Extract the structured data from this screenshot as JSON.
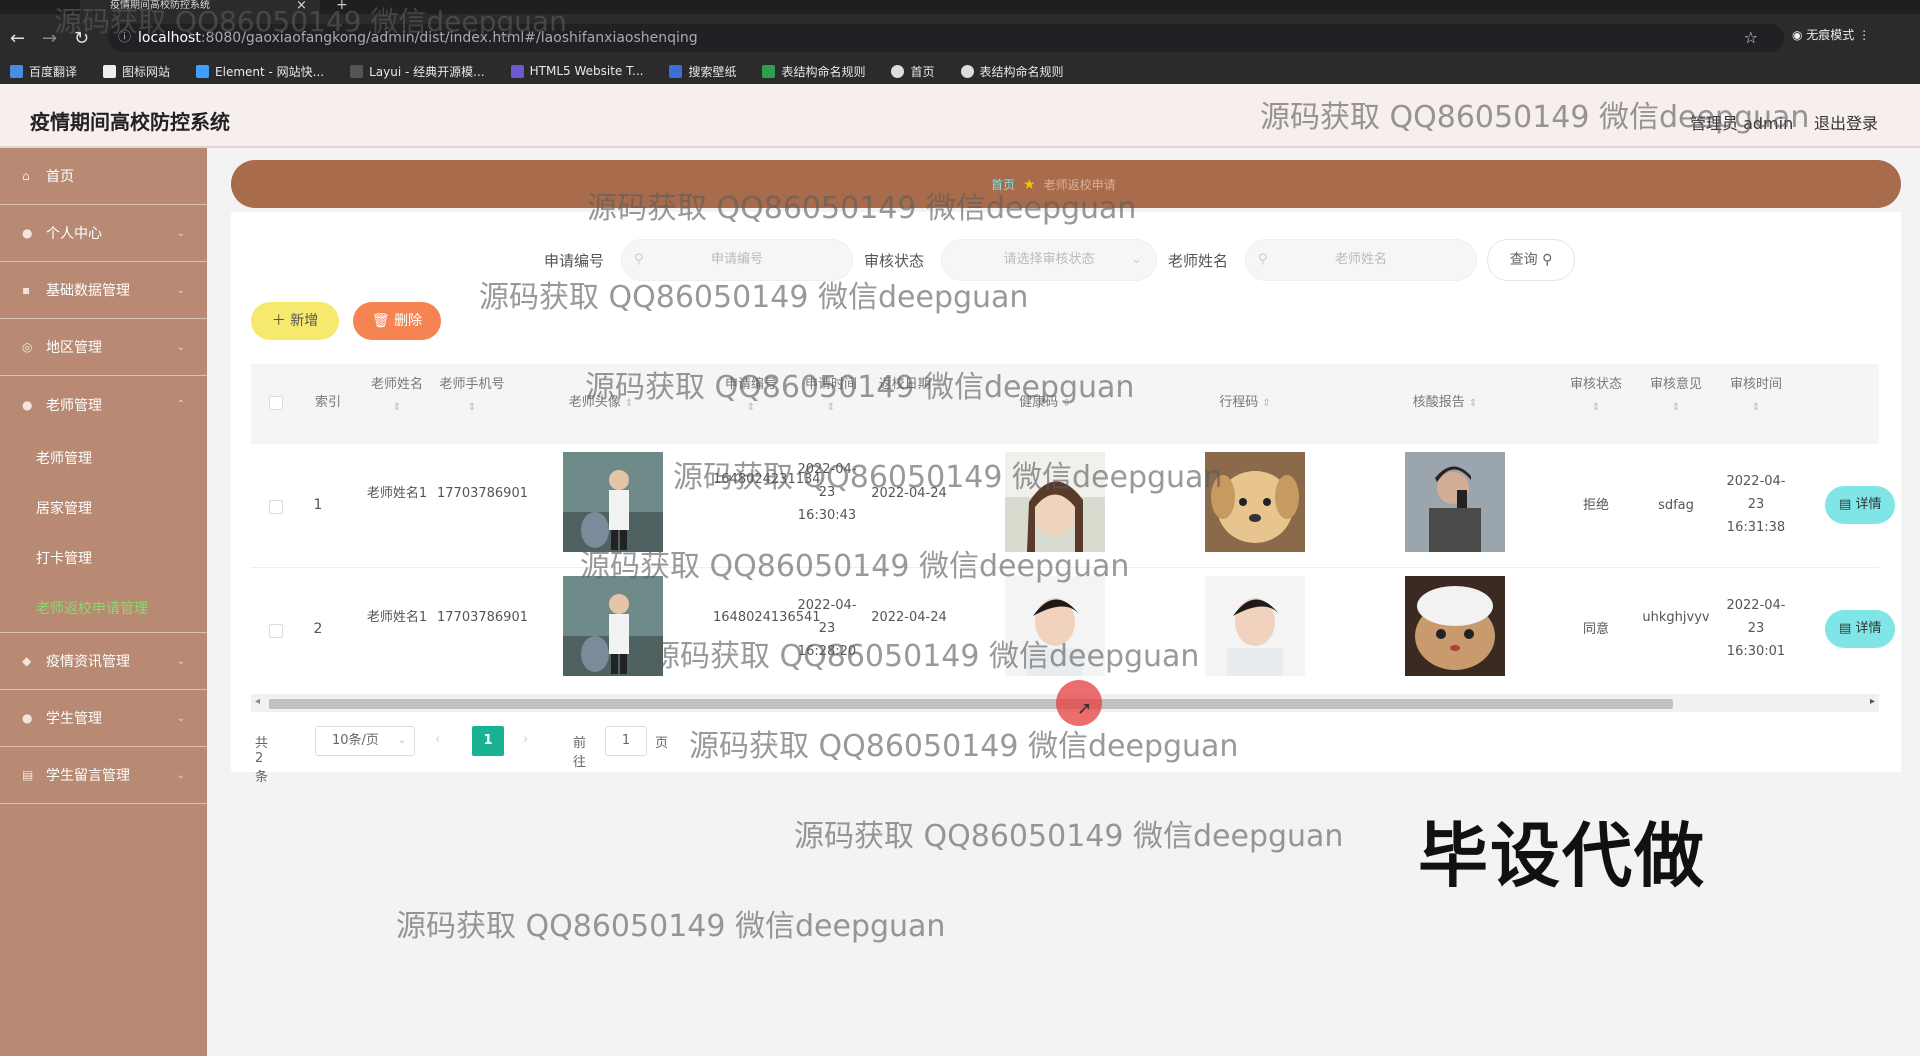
{
  "browser": {
    "tab_title": "疫情期间高校防控系统",
    "url_host": "localhost",
    "url_rest": ":8080/gaoxiaofangkong/admin/dist/index.html#/laoshifanxiaoshenqing",
    "incognito_label": "无痕模式",
    "bookmarks": [
      "百度翻译",
      "图标网站",
      "Element - 网站快...",
      "Layui - 经典开源模...",
      "HTML5 Website T...",
      "搜索壁纸",
      "表结构命名规则",
      "首页",
      "表结构命名规则"
    ]
  },
  "header": {
    "title": "疫情期间高校防控系统",
    "user": "管理员 admin",
    "logout": "退出登录"
  },
  "sidebar": {
    "items": [
      {
        "label": "首页"
      },
      {
        "label": "个人中心"
      },
      {
        "label": "基础数据管理"
      },
      {
        "label": "地区管理"
      },
      {
        "label": "老师管理"
      }
    ],
    "subitems": [
      "老师管理",
      "居家管理",
      "打卡管理",
      "老师返校申请管理"
    ],
    "items_after": [
      {
        "label": "疫情资讯管理"
      },
      {
        "label": "学生管理"
      },
      {
        "label": "学生留言管理"
      }
    ]
  },
  "breadcrumb": {
    "home": "首页",
    "current": "老师返校申请"
  },
  "search": {
    "label1": "申请编号",
    "placeholder1": "申请编号",
    "label2": "审核状态",
    "placeholder2": "请选择审核状态",
    "label3": "老师姓名",
    "placeholder3": "老师姓名",
    "query": "查询"
  },
  "actions": {
    "add": "新增",
    "delete": "删除"
  },
  "table": {
    "headers": [
      "索引",
      "老师姓名",
      "老师手机号",
      "老师头像",
      "申请编号",
      "申请时间",
      "返校日期",
      "健康码",
      "行程码",
      "核酸报告",
      "审核状态",
      "审核意见",
      "审核时间"
    ],
    "rows": [
      {
        "index": "1",
        "name": "老师姓名1",
        "phone": "17703786901",
        "apply_no": "1648024231134",
        "apply_time": "2022-04-23 16:30:43",
        "return_date": "2022-04-24",
        "status": "拒绝",
        "opinion": "sdfag",
        "review_time": "2022-04-23 16:31:38",
        "detail": "详情"
      },
      {
        "index": "2",
        "name": "老师姓名1",
        "phone": "17703786901",
        "apply_no": "1648024136541",
        "apply_time": "2022-04-23 16:28:20",
        "return_date": "2022-04-24",
        "status": "同意",
        "opinion": "uhkghjvyv",
        "review_time": "2022-04-23 16:30:01",
        "detail": "详情"
      }
    ]
  },
  "pager": {
    "total": "共 2 条",
    "size": "10条/页",
    "current": "1",
    "goto": "前往",
    "goto_value": "1",
    "page_suffix": "页"
  },
  "watermark": "源码获取 QQ86050149 微信deepguan",
  "watermark_big": "毕设代做"
}
